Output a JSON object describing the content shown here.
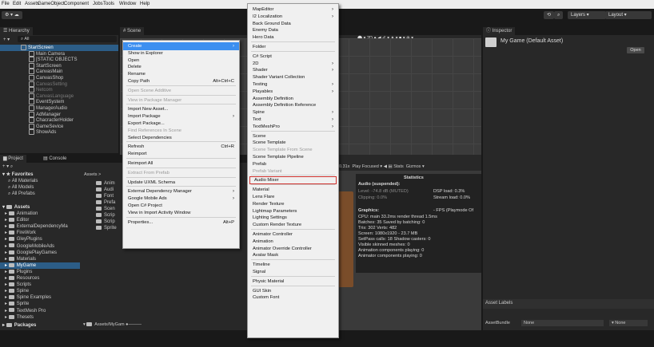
{
  "menubar": [
    "File",
    "Edit",
    "Assets",
    "GameObject",
    "Component",
    "Jobs",
    "Tools",
    "Window",
    "Help"
  ],
  "toolbar": {
    "layers": "Layers",
    "layout": "Layout"
  },
  "hierarchy": {
    "tab": "Hierarchy",
    "search": "All",
    "items": [
      {
        "label": "StartScreen",
        "indent": 0,
        "selected": true,
        "dim": false
      },
      {
        "label": "Main Camera",
        "indent": 1,
        "dim": false
      },
      {
        "label": "[STATIC OBJECTS",
        "indent": 1,
        "dim": false
      },
      {
        "label": "StartScreen",
        "indent": 1,
        "dim": false
      },
      {
        "label": "CanvasMain",
        "indent": 1,
        "dim": false
      },
      {
        "label": "CanvasShop",
        "indent": 1,
        "dim": false
      },
      {
        "label": "CanvasSetting",
        "indent": 1,
        "dim": true
      },
      {
        "label": "Netcom",
        "indent": 1,
        "dim": true
      },
      {
        "label": "CanvasLanguage",
        "indent": 1,
        "dim": true
      },
      {
        "label": "EventSystem",
        "indent": 1,
        "dim": false
      },
      {
        "label": "ManagerAudio",
        "indent": 1,
        "dim": false
      },
      {
        "label": "AdManager",
        "indent": 1,
        "dim": false
      },
      {
        "label": "ChacracterHolder",
        "indent": 1,
        "dim": false
      },
      {
        "label": "GameSevice",
        "indent": 1,
        "dim": false
      },
      {
        "label": "ShowAds",
        "indent": 1,
        "dim": false
      }
    ]
  },
  "scene": {
    "tab": "Scene"
  },
  "inspector": {
    "tab": "Inspector",
    "title": "My Game (Default Asset)",
    "open": "Open",
    "asset_labels": "Asset Labels",
    "asset_bundle": "AssetBundle",
    "none1": "None",
    "none2": "None"
  },
  "project": {
    "tabs": [
      "Project",
      "Console"
    ],
    "favorites": "Favorites",
    "fav_items": [
      "All Materials",
      "All Models",
      "All Prefabs"
    ],
    "assets": "Assets",
    "asset_items": [
      "Animation",
      "Editor",
      "ExternalDependencyMa",
      "FireWork",
      "GleyPlugins",
      "GoogleMobileAds",
      "GooglePlayGames",
      "Materials",
      "MyGame",
      "Plugins",
      "Resources",
      "Scripts",
      "Spine",
      "Spine Examples",
      "Sprite",
      "TextMesh Pro",
      "Thesets"
    ],
    "packages": "Packages",
    "breadcrumb": "Assets > ",
    "right_items": [
      "Anim",
      "Audi",
      "Font",
      "Prefa",
      "Scen",
      "Scrip",
      "Scrip",
      "Sprite"
    ],
    "path": "Assets/MyGam"
  },
  "game": {
    "zoom": "0.31x",
    "play": "Play Focused",
    "stats": "Stats",
    "gizmos": "Gizmos"
  },
  "stats": {
    "title": "Statistics",
    "audio": "Audio (suspended):",
    "level": "Level: -74.8 dB (MUTED)",
    "clipping": "Clipping: 0.0%",
    "dsp": "DSP load: 0.3%",
    "stream": "Stream load: 0.0%",
    "graphics": "Graphics:",
    "fps": "- FPS (Playmode Of",
    "lines": [
      "CPU: main 33.2ms  render thread 1.5ms",
      "Batches: 35   Saved by batching: 0",
      "Tris: 302     Verts: 482",
      "Screen: 1080x1920 - 23.7 MB",
      "SetPass calls: 18       Shadow casters: 0",
      "Visible skinned meshes: 0",
      "Animation components playing: 0",
      "Animator components playing: 0"
    ]
  },
  "context_menu": {
    "items": [
      {
        "label": "Create",
        "hl": true,
        "arrow": true
      },
      {
        "label": "Show in Explorer"
      },
      {
        "label": "Open"
      },
      {
        "label": "Delete"
      },
      {
        "label": "Rename"
      },
      {
        "label": "Copy Path",
        "shortcut": "Alt+Ctrl+C"
      },
      {
        "sep": true
      },
      {
        "label": "Open Scene Additive",
        "dis": true
      },
      {
        "sep": true
      },
      {
        "label": "View in Package Manager",
        "dis": true
      },
      {
        "sep": true
      },
      {
        "label": "Import New Asset..."
      },
      {
        "label": "Import Package",
        "arrow": true
      },
      {
        "label": "Export Package..."
      },
      {
        "label": "Find References In Scene",
        "dis": true
      },
      {
        "label": "Select Dependencies"
      },
      {
        "sep": true
      },
      {
        "label": "Refresh",
        "shortcut": "Ctrl+R"
      },
      {
        "label": "Reimport"
      },
      {
        "sep": true
      },
      {
        "label": "Reimport All"
      },
      {
        "sep": true
      },
      {
        "label": "Extract From Prefab",
        "dis": true
      },
      {
        "sep": true
      },
      {
        "label": "Update UXML Schema"
      },
      {
        "sep": true
      },
      {
        "label": "External Dependency Manager",
        "arrow": true
      },
      {
        "label": "Google Mobile Ads",
        "arrow": true
      },
      {
        "label": "Open C# Project"
      },
      {
        "label": "View in Import Activity Window"
      },
      {
        "sep": true
      },
      {
        "label": "Properties...",
        "shortcut": "Alt+P"
      }
    ]
  },
  "create_menu": {
    "items": [
      {
        "label": "MapEditor",
        "arrow": true
      },
      {
        "label": "I2 Localization",
        "arrow": true
      },
      {
        "label": "Back Ground Data"
      },
      {
        "label": "Enemy Data"
      },
      {
        "label": "Hero Data"
      },
      {
        "sep": true
      },
      {
        "label": "Folder"
      },
      {
        "sep": true
      },
      {
        "label": "C# Script"
      },
      {
        "label": "2D",
        "arrow": true
      },
      {
        "label": "Shader",
        "arrow": true
      },
      {
        "label": "Shader Variant Collection"
      },
      {
        "label": "Testing",
        "arrow": true
      },
      {
        "label": "Playables",
        "arrow": true
      },
      {
        "label": "Assembly Definition"
      },
      {
        "label": "Assembly Definition Reference"
      },
      {
        "label": "Spine",
        "arrow": true
      },
      {
        "label": "Text",
        "arrow": true
      },
      {
        "label": "TextMeshPro",
        "arrow": true
      },
      {
        "sep": true
      },
      {
        "label": "Scene"
      },
      {
        "label": "Scene Template"
      },
      {
        "label": "Scene Template From Scene",
        "dis": true
      },
      {
        "label": "Scene Template Pipeline"
      },
      {
        "label": "Prefab"
      },
      {
        "label": "Prefab Variant",
        "dis": true
      },
      {
        "sep": true
      },
      {
        "label": "Audio Mixer",
        "boxed": true
      },
      {
        "sep": true
      },
      {
        "label": "Material"
      },
      {
        "label": "Lens Flare"
      },
      {
        "label": "Render Texture"
      },
      {
        "label": "Lightmap Parameters"
      },
      {
        "label": "Lighting Settings"
      },
      {
        "label": "Custom Render Texture"
      },
      {
        "sep": true
      },
      {
        "label": "Animator Controller"
      },
      {
        "label": "Animation"
      },
      {
        "label": "Animator Override Controller"
      },
      {
        "label": "Avatar Mask"
      },
      {
        "sep": true
      },
      {
        "label": "Timeline"
      },
      {
        "label": "Signal"
      },
      {
        "sep": true
      },
      {
        "label": "Physic Material"
      },
      {
        "sep": true
      },
      {
        "label": "GUI Skin"
      },
      {
        "label": "Custom Font"
      }
    ]
  }
}
